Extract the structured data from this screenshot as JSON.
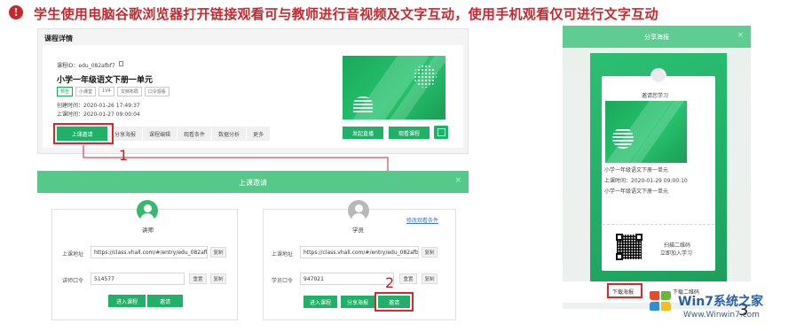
{
  "headline": {
    "icon": "alert-icon",
    "text": "学生使用电脑谷歌浏览器打开链接观看可与教师进行音视频及文字互动，使用手机观看仅可进行文字互动"
  },
  "course": {
    "section_title": "课程详情",
    "id_label": "课程ID：edu_082afbf7",
    "name": "小学一年级语文下册一单元",
    "tags": [
      "预告",
      "小课堂",
      "1V4",
      "文档布局",
      "口令观看"
    ],
    "created": "创建时间：2020-01-26 17:49:37",
    "start": "上课时间：2020-01-27 09:00:04",
    "actions": [
      "上课邀请",
      "分享海报",
      "课程编辑",
      "观看条件",
      "数据分析",
      "更多"
    ],
    "btn_live": "发起直播",
    "btn_view": "观看课程"
  },
  "dialog": {
    "title": "上课邀请",
    "close": "×",
    "teacher": {
      "role": "讲师",
      "address_label": "上课地址",
      "address_value": "https://class.vhall.com/#/entry/edu_082afbf7",
      "copy": "复制",
      "code_label": "讲师口令",
      "code_value": "514577",
      "reset": "重置",
      "enter": "进入课程",
      "invite": "邀请"
    },
    "student": {
      "role": "学员",
      "edit_link": "修改观看条件",
      "address_label": "上课地址",
      "address_value": "https://class.vhall.com/#/entry/edu_082afbf7",
      "copy": "复制",
      "code_label": "学员口令",
      "code_value": "947021",
      "reset": "重置",
      "enter": "进入课程",
      "share": "分享海报",
      "invite": "邀请"
    }
  },
  "poster": {
    "title": "分享海报",
    "close": "×",
    "invite_text": "邀请您学习",
    "course_name": "小学一年级语文下册一单元",
    "start": "上课时间：2020-01-29 09:00:10",
    "desc": "小学一年级语文下册一单元",
    "scan_line1": "扫描二维码",
    "scan_line2": "立即加入学习",
    "download": "下载海报",
    "download_qr": "下载二维码"
  },
  "annotations": [
    "1",
    "2",
    "3"
  ],
  "watermark": {
    "brand": "Win7系统之家",
    "url": "Www.Winwin7.com"
  },
  "colors": {
    "accent_green": "#21b067",
    "annotation_red": "#c7282e",
    "link_blue": "#3e79c8"
  }
}
